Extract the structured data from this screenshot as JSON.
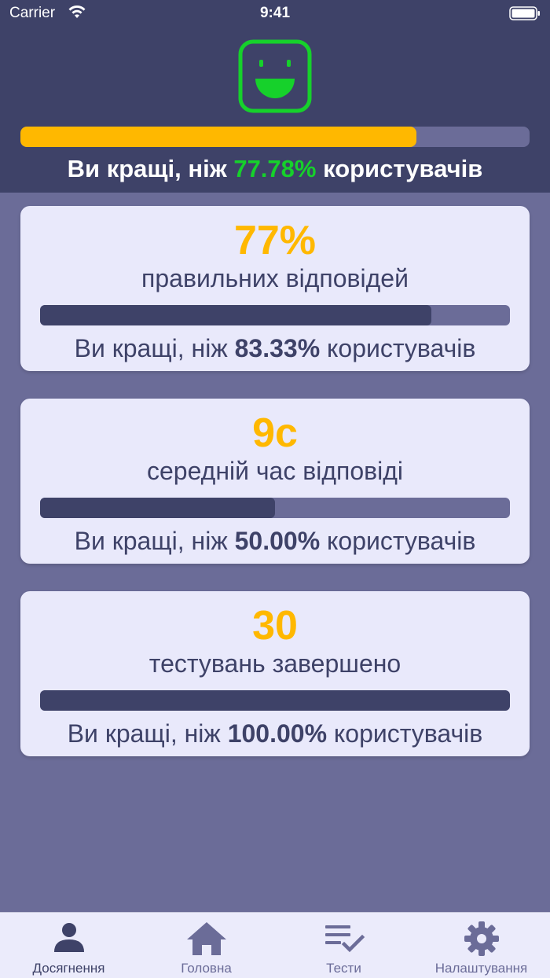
{
  "status_bar": {
    "carrier": "Carrier",
    "time": "9:41"
  },
  "header": {
    "overall_percentile": 0.7778,
    "text_prefix": "Ви кращі, ніж ",
    "percent": "77.78%",
    "text_suffix": " користувачів"
  },
  "colors": {
    "header_bg": "#3e4268",
    "page_bg": "#6b6c98",
    "accent_yellow": "#ffb800",
    "accent_green": "#16d12b",
    "card_bg": "#e9e9fb"
  },
  "cards": [
    {
      "value": "77%",
      "label": "правильних відповідей",
      "compare_prefix": "Ви кращі, ніж ",
      "percent": "83.33%",
      "compare_suffix": " користувачів",
      "progress": 0.8333
    },
    {
      "value": "9с",
      "label": "середній час відповіді",
      "compare_prefix": "Ви кращі, ніж ",
      "percent": "50.00%",
      "compare_suffix": " користувачів",
      "progress": 0.5
    },
    {
      "value": "30",
      "label": "тестувань завершено",
      "compare_prefix": "Ви кращі, ніж ",
      "percent": "100.00%",
      "compare_suffix": " користувачів",
      "progress": 1.0
    }
  ],
  "tabs": [
    {
      "label": "Досягнення",
      "icon": "person-icon",
      "active": true
    },
    {
      "label": "Головна",
      "icon": "home-icon",
      "active": false
    },
    {
      "label": "Тести",
      "icon": "checklist-icon",
      "active": false
    },
    {
      "label": "Налаштування",
      "icon": "gear-icon",
      "active": false
    }
  ]
}
